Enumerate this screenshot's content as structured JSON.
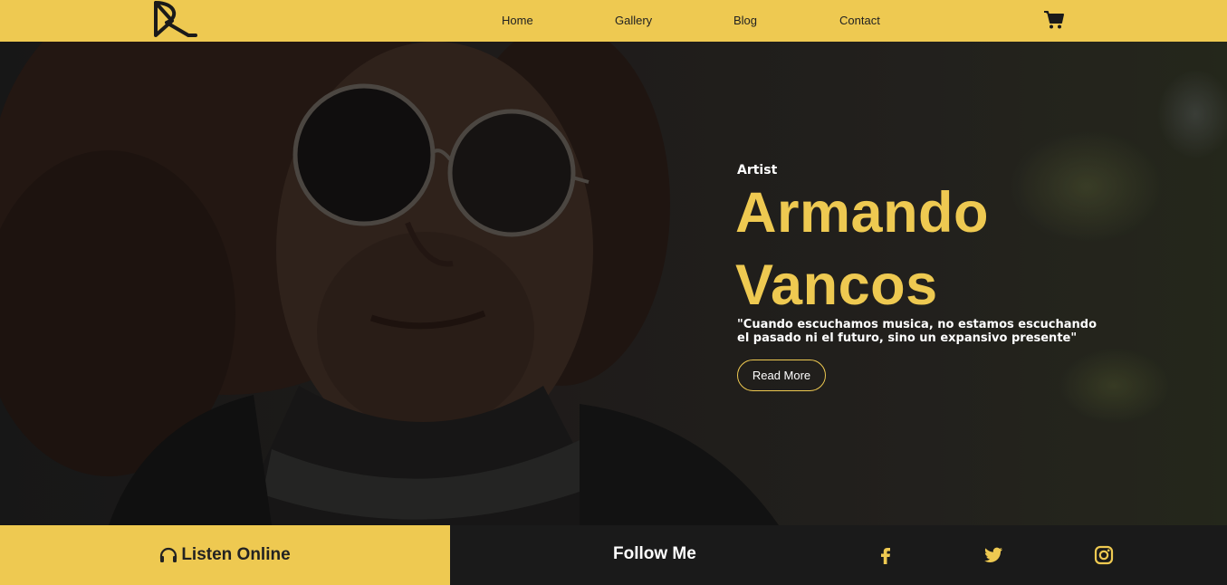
{
  "nav": {
    "items": [
      {
        "label": "Home"
      },
      {
        "label": "Gallery"
      },
      {
        "label": "Blog"
      },
      {
        "label": "Contact"
      }
    ]
  },
  "hero": {
    "subtitle": "Artist",
    "name_line1": "Armando",
    "name_line2": "Vancos",
    "quote": "\"Cuando escuchamos musica, no estamos escuchando el pasado ni el futuro, sino un expansivo presente\"",
    "button_label": "Read More"
  },
  "footer": {
    "listen_label": "Listen Online",
    "follow_label": "Follow Me",
    "social": [
      "facebook-icon",
      "twitter-icon",
      "instagram-icon"
    ]
  },
  "colors": {
    "accent": "#eec951",
    "dark": "#1a1a1a",
    "text_dark": "#222222"
  }
}
